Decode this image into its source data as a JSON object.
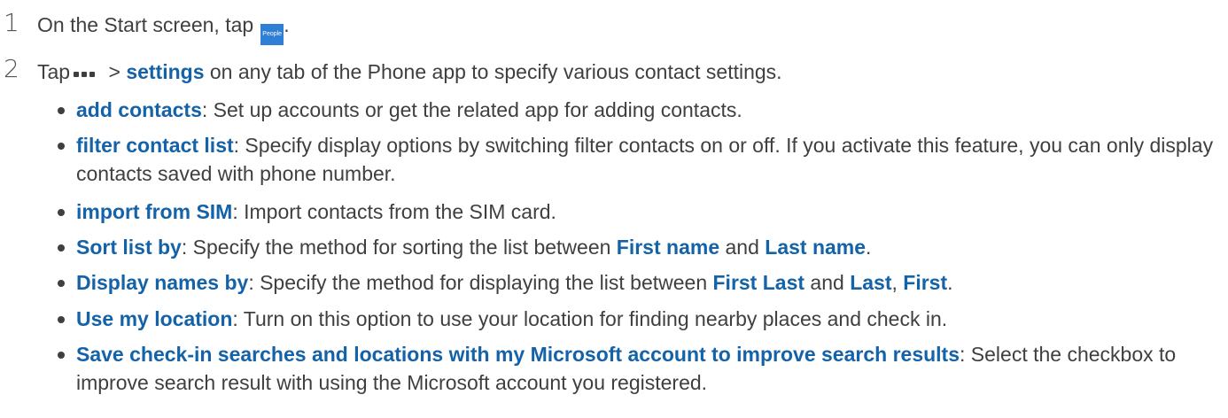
{
  "step1": {
    "number": "1",
    "text_before": "On the Start screen, tap",
    "tile_label": "People",
    "text_after": "."
  },
  "step2": {
    "number": "2",
    "text_before": "Tap",
    "text_mid": " > ",
    "kw_settings": "settings",
    "text_after": " on any tab of the Phone app to specify various contact settings."
  },
  "bullets": [
    {
      "term": "add contacts",
      "desc": ": Set up accounts or get the related app for adding contacts."
    },
    {
      "term": "filter contact list",
      "desc": ": Specify display options by switching filter contacts on or off. If you activate this feature, you can only display contacts saved with phone number."
    },
    {
      "term": "import from SIM",
      "desc": ": Import contacts from the SIM card."
    },
    {
      "term": "Sort list by",
      "desc1": ": Specify the method for sorting the list between ",
      "opt1": "First name",
      "mid": " and ",
      "opt2": "Last name",
      "end": "."
    },
    {
      "term": "Display names by",
      "desc1": ": Specify the method for displaying the list between ",
      "opt1": "First Last",
      "mid": " and ",
      "opt2": "Last",
      "comma": ", ",
      "opt3": "First",
      "end": "."
    },
    {
      "term": "Use my location",
      "desc": ": Turn on this option to use your location for finding nearby places and check in."
    },
    {
      "term": "Save check-in searches and locations with my Microsoft account to improve search results",
      "desc": ": Select the checkbox to improve search result with using the Microsoft account you registered."
    }
  ],
  "colors": {
    "keyword": "#1462a8",
    "text": "#3f3f3f",
    "tile": "#2f7fd4"
  },
  "icons": {
    "people_tile": "people-tile-icon",
    "more": "more-dots-icon"
  }
}
